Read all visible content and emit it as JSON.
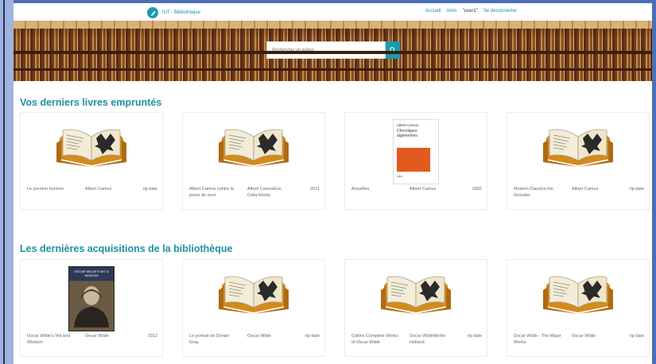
{
  "nav": {
    "brand": "IUT - Bibliothèque",
    "links": [
      {
        "label": "Accueil"
      },
      {
        "label": "Amis"
      },
      {
        "label": "\"user1\""
      },
      {
        "label": "Se déconnecter"
      }
    ]
  },
  "search": {
    "placeholder": "Rechercher un auteur"
  },
  "sections": [
    {
      "title": "Vos derniers livres empruntés",
      "books": [
        {
          "title": "Le premier homme",
          "author": "Albert Camus",
          "date": "rip date",
          "cover": "book-icon"
        },
        {
          "title": "Albert Camus contre la peine de mort",
          "author": "Albert CamusEve Celia Morisi",
          "date": "2011",
          "cover": "book-icon"
        },
        {
          "title": "Actuelles",
          "author": "Albert Camus",
          "date": "2002",
          "cover": "camus-cover"
        },
        {
          "title": "Modern Classics the Outsider",
          "author": "Albert Camus",
          "date": "rip date",
          "cover": "book-icon"
        }
      ]
    },
    {
      "title": "Les dernières acquisitions de la bibliothèque",
      "books": [
        {
          "title": "Oscar Wilde's Wit and Wisdom",
          "author": "Oscar Wilde",
          "date": "2012",
          "cover": "wilde-cover"
        },
        {
          "title": "Le portrait de Dorian Gray",
          "author": "Oscar Wilde",
          "date": "rip date",
          "cover": "book-icon"
        },
        {
          "title": "Collins Complete Works of Oscar Wilde",
          "author": "Oscar WildeMerlin Holland",
          "date": "rip date",
          "cover": "book-icon"
        },
        {
          "title": "Oscar Wilde - The Major Works",
          "author": "Oscar Wilde",
          "date": "rip date",
          "cover": "book-icon"
        }
      ]
    }
  ],
  "colors": {
    "accent": "#1a9bb0",
    "title": "#1f8fa4",
    "outer_bg": "#4a6fb5"
  },
  "covers": {
    "camus": {
      "author": "Albert Camus",
      "title": "Chroniques algériennes",
      "publisher": "folio"
    },
    "wilde": {
      "title": "OSCAR WILDE'S WIT & WISDOM"
    }
  }
}
